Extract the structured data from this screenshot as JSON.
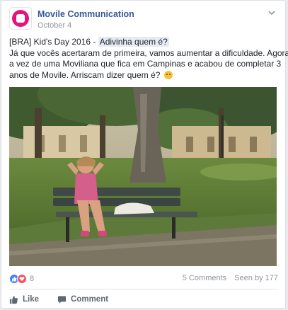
{
  "post": {
    "page_name": "Movile Communication",
    "date": "October 4",
    "text": {
      "line1_prefix": "[BRA] Kid's Day 2016 - ",
      "line1_highlight": "Adivinha quem é?",
      "line2": "Já que vocês acertaram de primeira, vamos aumentar a dificuldade. Agora é",
      "line3": "a vez de uma Moviliana que fica em Campinas e acabou de completar 3",
      "line4": "anos de Movile. Arriscam dizer quem é?"
    }
  },
  "stats": {
    "reactions_count": "8",
    "comments": "5 Comments",
    "seen_by": "Seen by 177"
  },
  "actions": {
    "like_label": "Like",
    "comment_label": "Comment"
  },
  "icons": {
    "avatar": "movile-logo-icon",
    "menu": "chevron-down-icon",
    "emoji": "smile-emoji-icon",
    "reaction_like": "thumbs-up-icon",
    "reaction_love": "heart-icon"
  },
  "colors": {
    "brand_link": "#365899",
    "brand_logo": "#e6127e",
    "meta_text": "#90949c",
    "like_reaction": "#4080ff",
    "love_reaction": "#f25268"
  }
}
